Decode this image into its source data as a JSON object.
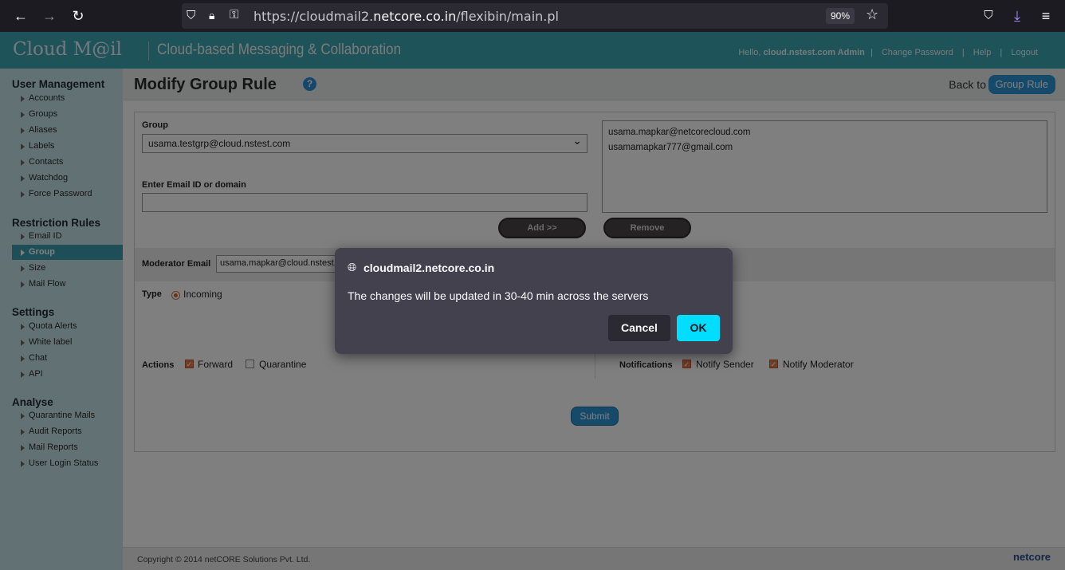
{
  "browser": {
    "url_prefix": "https://cloudmail2.",
    "url_domain": "netcore.co.in",
    "url_path": "/flexibin/main.pl",
    "zoom": "90%"
  },
  "header": {
    "logo": "Cloud M@il",
    "tagline": "Cloud-based Messaging & Collaboration",
    "hello": "Hello,",
    "user": "cloud.nstest.com Admin",
    "change_password": "Change Password",
    "help": "Help",
    "logout": "Logout"
  },
  "sidebar": {
    "user_management": {
      "title": "User Management",
      "items": [
        "Accounts",
        "Groups",
        "Aliases",
        "Labels",
        "Contacts",
        "Watchdog",
        "Force Password"
      ]
    },
    "restriction_rules": {
      "title": "Restriction Rules",
      "items": [
        "Email ID",
        "Group",
        "Size",
        "Mail Flow"
      ]
    },
    "settings": {
      "title": "Settings",
      "items": [
        "Quota Alerts",
        "White label",
        "Chat",
        "API"
      ]
    },
    "analyse": {
      "title": "Analyse",
      "items": [
        "Quarantine Mails",
        "Audit Reports",
        "Mail Reports",
        "User Login Status"
      ]
    }
  },
  "main": {
    "title": "Modify Group Rule",
    "help_icon": "?",
    "back_to": "Back to",
    "group_rule_button": "Group Rule",
    "group_label": "Group",
    "group_value": "usama.testgrp@cloud.nstest.com",
    "email_label": "Enter Email ID or domain",
    "email_value": "",
    "email_list": [
      "usama.mapkar@netcorecloud.com",
      "usamamapkar777@gmail.com"
    ],
    "add_button": "Add >>",
    "remove_button": "Remove",
    "moderator_label": "Moderator Email",
    "moderator_value": "usama.mapkar@cloud.nstest.c",
    "type_label": "Type",
    "type_value": "Incoming",
    "actions_label": "Actions",
    "forward": "Forward",
    "quarantine": "Quarantine",
    "notifications_label": "Notifications",
    "notify_sender": "Notify Sender",
    "notify_moderator": "Notify Moderator",
    "submit": "Submit"
  },
  "footer": {
    "copyright": "Copyright © 2014 netCORE Solutions Pvt. Ltd.",
    "brand": "netcore"
  },
  "dialog": {
    "origin": "cloudmail2.netcore.co.in",
    "message": "The changes will be updated in 30-40 min across the servers",
    "cancel": "Cancel",
    "ok": "OK"
  },
  "colors": {
    "header": "#3ca7b3",
    "sidebar": "#c4e3e7",
    "accent": "#2a95d6",
    "dialog_ok": "#00ddff"
  }
}
